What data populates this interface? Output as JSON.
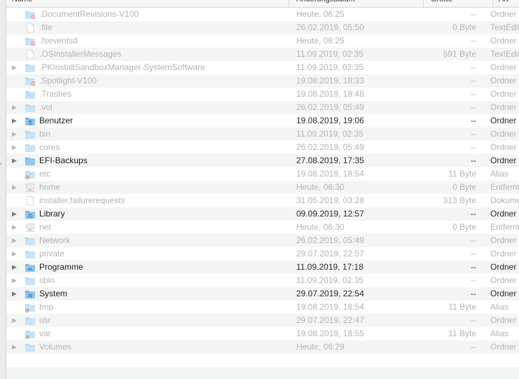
{
  "columns": {
    "name": "Name",
    "date": "Änderungsdatum",
    "size": "Größe",
    "kind": "Art"
  },
  "colors": {
    "folder": "#8fc8f3",
    "folder_dim": "#c9e3f8",
    "text_dim": "#b3b3b3",
    "row_alt": "#f4f5f5"
  },
  "rows": [
    {
      "name": ".DocumentRevisions-V100",
      "date": "Heute, 06:25",
      "size": "--",
      "kind": "Ordner",
      "icon": "restricted-folder-icon",
      "disclosure": false,
      "dim": true
    },
    {
      "name": ".file",
      "date": "26.02.2019, 05:50",
      "size": "0 Byte",
      "kind": "TextEdit",
      "icon": "document-icon",
      "disclosure": false,
      "dim": true
    },
    {
      "name": ".fseventsd",
      "date": "Heute, 06:25",
      "size": "--",
      "kind": "Ordner",
      "icon": "restricted-folder-icon",
      "disclosure": false,
      "dim": true
    },
    {
      "name": ".OSInstallerMessages",
      "date": "11.09.2019, 02:35",
      "size": "591 Byte",
      "kind": "TextEdit",
      "icon": "document-icon",
      "disclosure": false,
      "dim": true
    },
    {
      "name": ".PKInstallSandboxManager-SystemSoftware",
      "date": "11.09.2019, 02:35",
      "size": "--",
      "kind": "Ordner",
      "icon": "folder-icon",
      "disclosure": true,
      "dim": true
    },
    {
      "name": ".Spotlight-V100",
      "date": "19.08.2019, 18:33",
      "size": "--",
      "kind": "Ordner",
      "icon": "restricted-folder-icon",
      "disclosure": false,
      "dim": true
    },
    {
      "name": ".Trashes",
      "date": "19.08.2019, 18:48",
      "size": "--",
      "kind": "Ordner",
      "icon": "dropbox-folder-icon",
      "disclosure": false,
      "dim": true
    },
    {
      "name": ".vol",
      "date": "26.02.2019, 05:49",
      "size": "--",
      "kind": "Ordner",
      "icon": "folder-icon",
      "disclosure": true,
      "dim": true
    },
    {
      "name": "Benutzer",
      "date": "19.08.2019, 19:06",
      "size": "--",
      "kind": "Ordner",
      "icon": "users-folder-icon",
      "disclosure": true,
      "dim": false
    },
    {
      "name": "bin",
      "date": "11.09.2019, 02:35",
      "size": "--",
      "kind": "Ordner",
      "icon": "folder-icon",
      "disclosure": true,
      "dim": true
    },
    {
      "name": "cores",
      "date": "26.02.2019, 05:49",
      "size": "--",
      "kind": "Ordner",
      "icon": "folder-icon",
      "disclosure": true,
      "dim": true
    },
    {
      "name": "EFI-Backups",
      "date": "27.08.2019, 17:35",
      "size": "--",
      "kind": "Ordner",
      "icon": "folder-icon",
      "disclosure": true,
      "dim": false
    },
    {
      "name": "etc",
      "date": "19.08.2019, 18:54",
      "size": "11 Byte",
      "kind": "Alias",
      "icon": "alias-folder-icon",
      "disclosure": false,
      "dim": true
    },
    {
      "name": "home",
      "date": "Heute, 06:30",
      "size": "0 Byte",
      "kind": "Entfernt",
      "icon": "server-volume-icon",
      "disclosure": true,
      "dim": true
    },
    {
      "name": "installer.failurerequests",
      "date": "31.05.2019, 03:28",
      "size": "313 Byte",
      "kind": "Dokument",
      "icon": "document-icon",
      "disclosure": false,
      "dim": true
    },
    {
      "name": "Library",
      "date": "09.09.2019, 12:57",
      "size": "--",
      "kind": "Ordner",
      "icon": "library-folder-icon",
      "disclosure": true,
      "dim": false
    },
    {
      "name": "net",
      "date": "Heute, 06:30",
      "size": "0 Byte",
      "kind": "Entfernt",
      "icon": "server-volume-icon",
      "disclosure": true,
      "dim": true
    },
    {
      "name": "Network",
      "date": "26.02.2019, 05:49",
      "size": "--",
      "kind": "Ordner",
      "icon": "folder-icon",
      "disclosure": true,
      "dim": true
    },
    {
      "name": "private",
      "date": "29.07.2019, 22:57",
      "size": "--",
      "kind": "Ordner",
      "icon": "folder-icon",
      "disclosure": true,
      "dim": true
    },
    {
      "name": "Programme",
      "date": "11.09.2019, 17:18",
      "size": "--",
      "kind": "Ordner",
      "icon": "applications-folder-icon",
      "disclosure": true,
      "dim": false
    },
    {
      "name": "sbin",
      "date": "11.09.2019, 02:35",
      "size": "--",
      "kind": "Ordner",
      "icon": "folder-icon",
      "disclosure": true,
      "dim": true
    },
    {
      "name": "System",
      "date": "29.07.2019, 22:54",
      "size": "--",
      "kind": "Ordner",
      "icon": "system-folder-icon",
      "disclosure": true,
      "dim": false
    },
    {
      "name": "tmp",
      "date": "19.08.2019, 18:54",
      "size": "11 Byte",
      "kind": "Alias",
      "icon": "alias-folder-icon",
      "disclosure": false,
      "dim": true
    },
    {
      "name": "usr",
      "date": "29.07.2019, 22:47",
      "size": "--",
      "kind": "Ordner",
      "icon": "folder-icon",
      "disclosure": true,
      "dim": true
    },
    {
      "name": "var",
      "date": "19.08.2019, 18:55",
      "size": "11 Byte",
      "kind": "Alias",
      "icon": "alias-folder-icon",
      "disclosure": false,
      "dim": true
    },
    {
      "name": "Volumes",
      "date": "Heute, 06:29",
      "size": "--",
      "kind": "Ordner",
      "icon": "folder-icon",
      "disclosure": true,
      "dim": true
    }
  ]
}
